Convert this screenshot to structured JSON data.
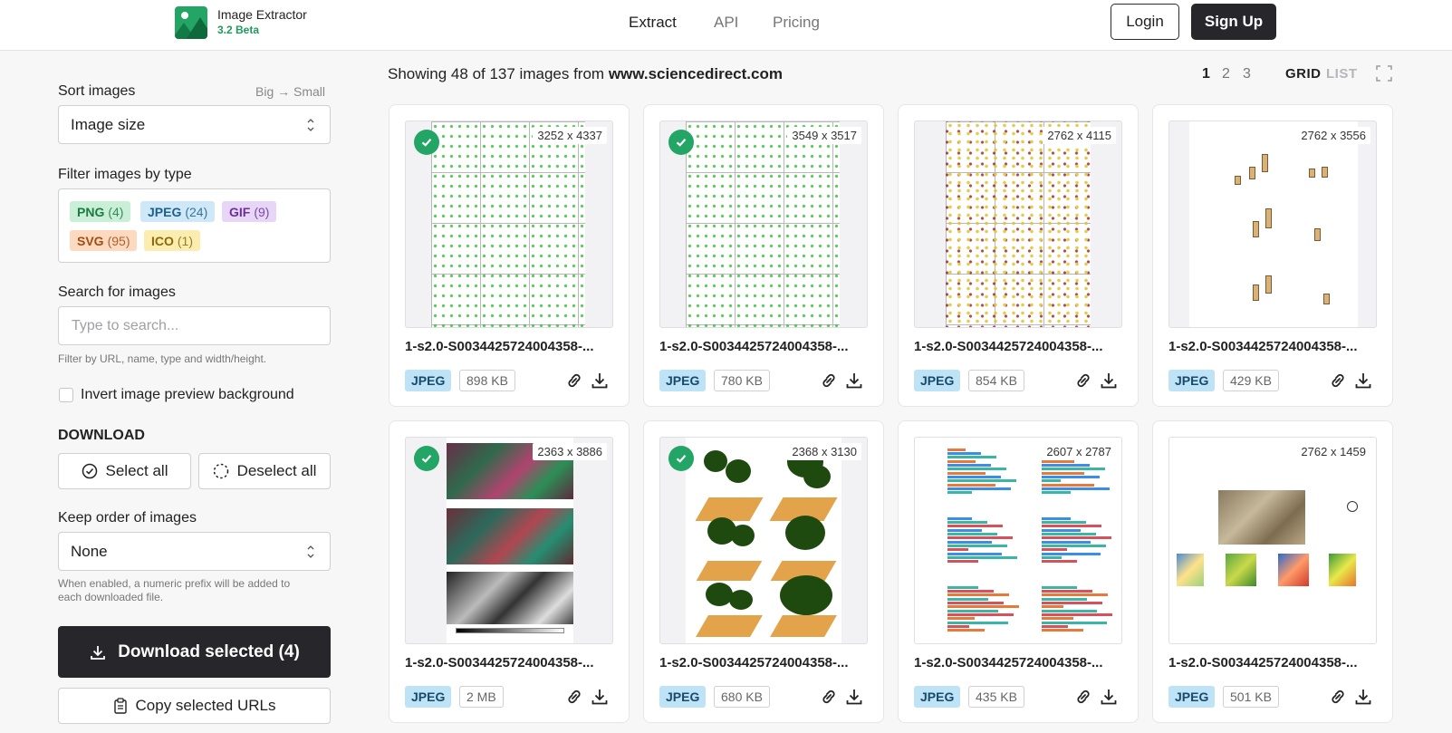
{
  "brand": {
    "name": "Image Extractor",
    "version": "3.2 Beta"
  },
  "nav": {
    "items": [
      "Extract",
      "API",
      "Pricing"
    ],
    "active": "Extract"
  },
  "auth": {
    "login": "Login",
    "signup": "Sign Up"
  },
  "sidebar": {
    "sort": {
      "label": "Sort images",
      "direction": "Big → Small",
      "value": "Image size"
    },
    "filter": {
      "label": "Filter images by type",
      "tags": [
        {
          "name": "PNG",
          "count": "(4)",
          "bg": "#c9efd6",
          "fg": "#1c7a43"
        },
        {
          "name": "JPEG",
          "count": "(24)",
          "bg": "#cfe8f8",
          "fg": "#1e5f8a"
        },
        {
          "name": "GIF",
          "count": "(9)",
          "bg": "#e7d6f6",
          "fg": "#6b2f9c"
        },
        {
          "name": "SVG",
          "count": "(95)",
          "bg": "#fcd9bf",
          "fg": "#a14d12"
        },
        {
          "name": "ICO",
          "count": "(1)",
          "bg": "#fbedb0",
          "fg": "#8a6a07"
        }
      ]
    },
    "search": {
      "label": "Search for images",
      "placeholder": "Type to search...",
      "hint": "Filter by URL, name, type and width/height."
    },
    "invert_label": "Invert image preview background",
    "download": {
      "heading": "DOWNLOAD",
      "select_all": "Select all",
      "deselect_all": "Deselect all",
      "order_label": "Keep order of images",
      "order_value": "None",
      "order_hint_1": "When enabled, a numeric prefix will be added to",
      "order_hint_2": "each downloaded file.",
      "download_selected": "Download selected (4)",
      "copy_urls": "Copy selected URLs"
    }
  },
  "main": {
    "showing_prefix": "Showing 48 of 137 images from",
    "domain": "www.sciencedirect.com",
    "pages": [
      "1",
      "2",
      "3"
    ],
    "active_page": "1",
    "views": [
      "GRID",
      "LIST"
    ],
    "active_view": "GRID",
    "images": [
      {
        "dims": "3252 x 4337",
        "name": "1-s2.0-S0034425724004358-...",
        "type": "JPEG",
        "size": "898 KB",
        "selected": true,
        "kind": "plots"
      },
      {
        "dims": "3549 x 3517",
        "name": "1-s2.0-S0034425724004358-...",
        "type": "JPEG",
        "size": "780 KB",
        "selected": true,
        "kind": "plots"
      },
      {
        "dims": "2762 x 4115",
        "name": "1-s2.0-S0034425724004358-...",
        "type": "JPEG",
        "size": "854 KB",
        "selected": false,
        "kind": "plots-yellow"
      },
      {
        "dims": "2762 x 3556",
        "name": "1-s2.0-S0034425724004358-...",
        "type": "JPEG",
        "size": "429 KB",
        "selected": false,
        "kind": "boxes"
      },
      {
        "dims": "2363 x 3886",
        "name": "1-s2.0-S0034425724004358-...",
        "type": "JPEG",
        "size": "2 MB",
        "selected": true,
        "kind": "satellite"
      },
      {
        "dims": "2368 x 3130",
        "name": "1-s2.0-S0034425724004358-...",
        "type": "JPEG",
        "size": "680 KB",
        "selected": true,
        "kind": "trees"
      },
      {
        "dims": "2607 x 2787",
        "name": "1-s2.0-S0034425724004358-...",
        "type": "JPEG",
        "size": "435 KB",
        "selected": false,
        "kind": "bars"
      },
      {
        "dims": "2762 x 1459",
        "name": "1-s2.0-S0034425724004358-...",
        "type": "JPEG",
        "size": "501 KB",
        "selected": false,
        "kind": "map"
      }
    ]
  }
}
